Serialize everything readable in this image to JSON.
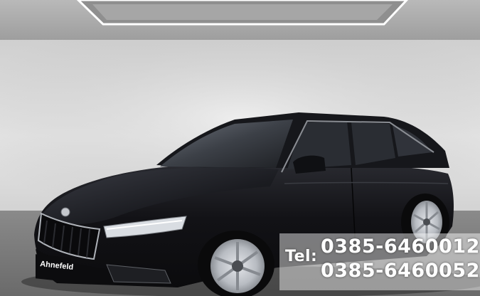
{
  "plate": {
    "text": "Ahnefeld"
  },
  "phone": {
    "label": "Tel:",
    "numbers": [
      "0385-6460012",
      "0385-6460052"
    ]
  },
  "colors": {
    "car_body": "#141418",
    "backdrop": "#d7d7d7",
    "floor": "#7c7c7c",
    "overlay": "#ffffff"
  }
}
